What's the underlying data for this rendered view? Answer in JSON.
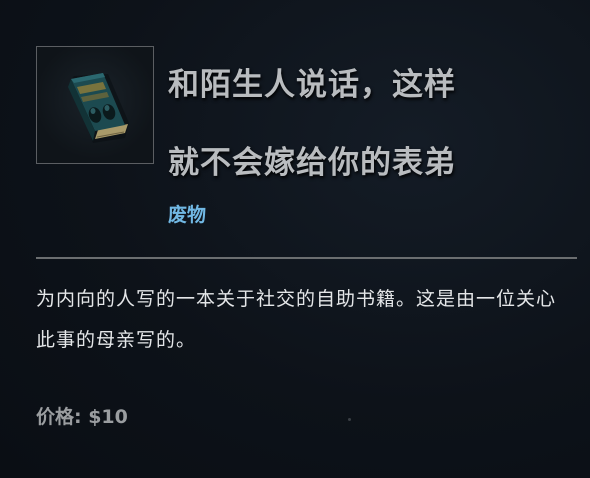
{
  "item": {
    "icon": "book-icon",
    "title_line1": "和陌生人说话，这样",
    "title_line2": "就不会嫁给你的表弟",
    "category": "废物",
    "description": "为内向的人写的一本关于社交的自助书籍。这是由一位关心此事的母亲写的。",
    "price": "价格: $10"
  },
  "colors": {
    "title": "#b9bcbf",
    "category": "#71b8e4",
    "description": "#e4e6e8",
    "price": "#9a9da0",
    "divider": "#6b6e70",
    "background": "#0d1219"
  }
}
